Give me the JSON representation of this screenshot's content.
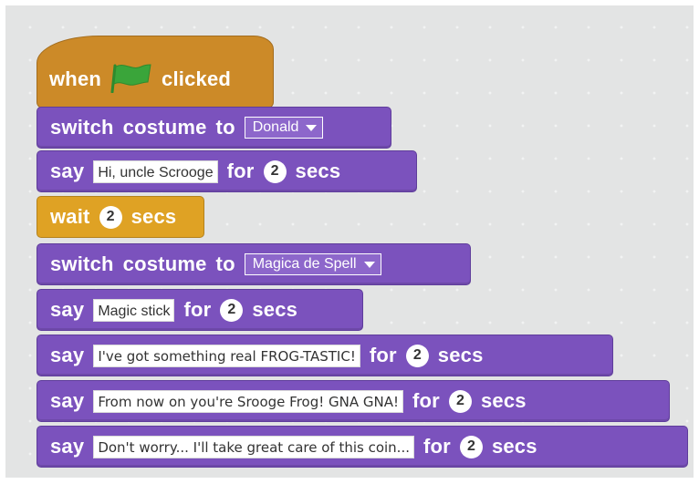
{
  "script": {
    "hat": {
      "when_label": "when",
      "flag_icon": "green-flag-icon",
      "clicked_label": "clicked"
    },
    "blocks": [
      {
        "type": "switch",
        "kw1": "switch",
        "kw2": "costume",
        "kw3": "to",
        "value": "Donald"
      },
      {
        "type": "say",
        "kw": "say",
        "text": "Hi, uncle Scrooge",
        "for": "for",
        "num": "2",
        "secs": "secs"
      },
      {
        "type": "wait",
        "kw": "wait",
        "num": "2",
        "secs": "secs"
      },
      {
        "type": "switch",
        "kw1": "switch",
        "kw2": "costume",
        "kw3": "to",
        "value": "Magica de Spell"
      },
      {
        "type": "say",
        "kw": "say",
        "text": "Magic stick",
        "for": "for",
        "num": "2",
        "secs": "secs"
      },
      {
        "type": "say",
        "kw": "say",
        "text": "I've got something real FROG-TASTIC!",
        "for": "for",
        "num": "2",
        "secs": "secs"
      },
      {
        "type": "say",
        "kw": "say",
        "text": "From now on you're Srooge Frog! GNA GNA!",
        "for": "for",
        "num": "2",
        "secs": "secs"
      },
      {
        "type": "say",
        "kw": "say",
        "text": "Don't worry... I'll take great care of this coin...",
        "for": "for",
        "num": "2",
        "secs": "secs"
      }
    ]
  },
  "colors": {
    "canvas": "#e3e4e4",
    "events": "#cc8a28",
    "control": "#dfa224",
    "looks": "#7b52bd",
    "flag": "#3aa53a"
  }
}
